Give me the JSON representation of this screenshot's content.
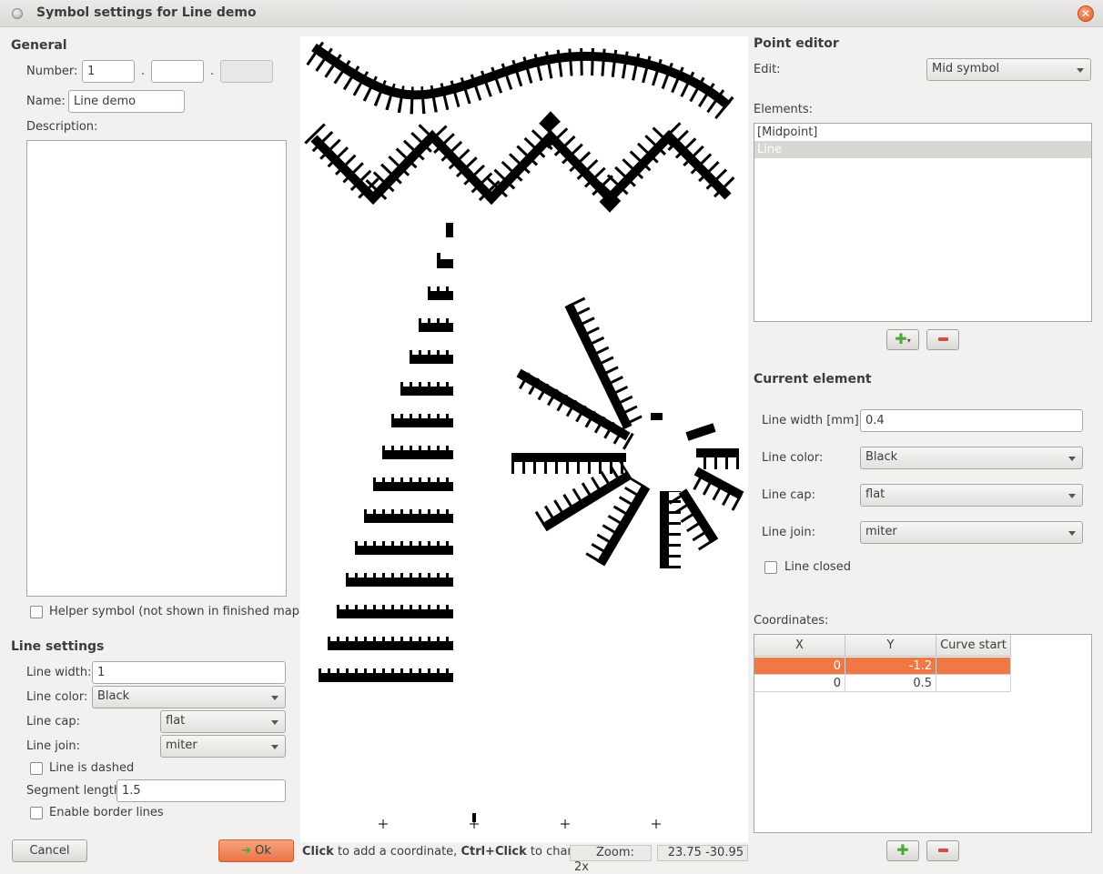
{
  "window": {
    "title": "Symbol settings for Line demo"
  },
  "general": {
    "heading": "General",
    "number_label": "Number:",
    "number_1": "1",
    "number_2": "",
    "number_3": "",
    "sep": ".",
    "name_label": "Name:",
    "name_value": "Line demo",
    "description_label": "Description:",
    "description_value": "",
    "helper_label": "Helper symbol (not shown in finished map)"
  },
  "line_settings": {
    "heading": "Line settings",
    "width_label": "Line width:",
    "width_value": "1",
    "color_label": "Line color:",
    "color_value": "Black",
    "cap_label": "Line cap:",
    "cap_value": "flat",
    "join_label": "Line join:",
    "join_value": "miter",
    "dashed_label": "Line is dashed",
    "segment_label": "Segment length:",
    "segment_value": "1.5",
    "border_label": "Enable border lines"
  },
  "buttons": {
    "cancel": "Cancel",
    "ok": "Ok"
  },
  "status": {
    "hint_bold_1": "Click",
    "hint_1": " to add a coordinate, ",
    "hint_bold_2": "Ctrl+Click",
    "hint_2": " to change",
    "zoom": "Zoom: 2x",
    "coords": "23.75 -30.95"
  },
  "point_editor": {
    "heading": "Point editor",
    "edit_label": "Edit:",
    "edit_value": "Mid symbol",
    "elements_label": "Elements:",
    "elements": [
      "[Midpoint]",
      "Line"
    ],
    "selected_element": 1
  },
  "current_element": {
    "heading": "Current element",
    "width_label": "Line width [mm]:",
    "width_value": "0.4",
    "color_label": "Line color:",
    "color_value": "Black",
    "cap_label": "Line cap:",
    "cap_value": "flat",
    "join_label": "Line join:",
    "join_value": "miter",
    "closed_label": "Line closed"
  },
  "coordinates": {
    "label": "Coordinates:",
    "columns": [
      "X",
      "Y",
      "Curve start"
    ],
    "rows": [
      {
        "x": "0",
        "y": "-1.2",
        "curve": ""
      },
      {
        "x": "0",
        "y": "0.5",
        "curve": ""
      }
    ],
    "selected_row": 0
  },
  "colors": {
    "accent": "#f07746",
    "add": "#4fa63b",
    "remove": "#d9493d"
  }
}
